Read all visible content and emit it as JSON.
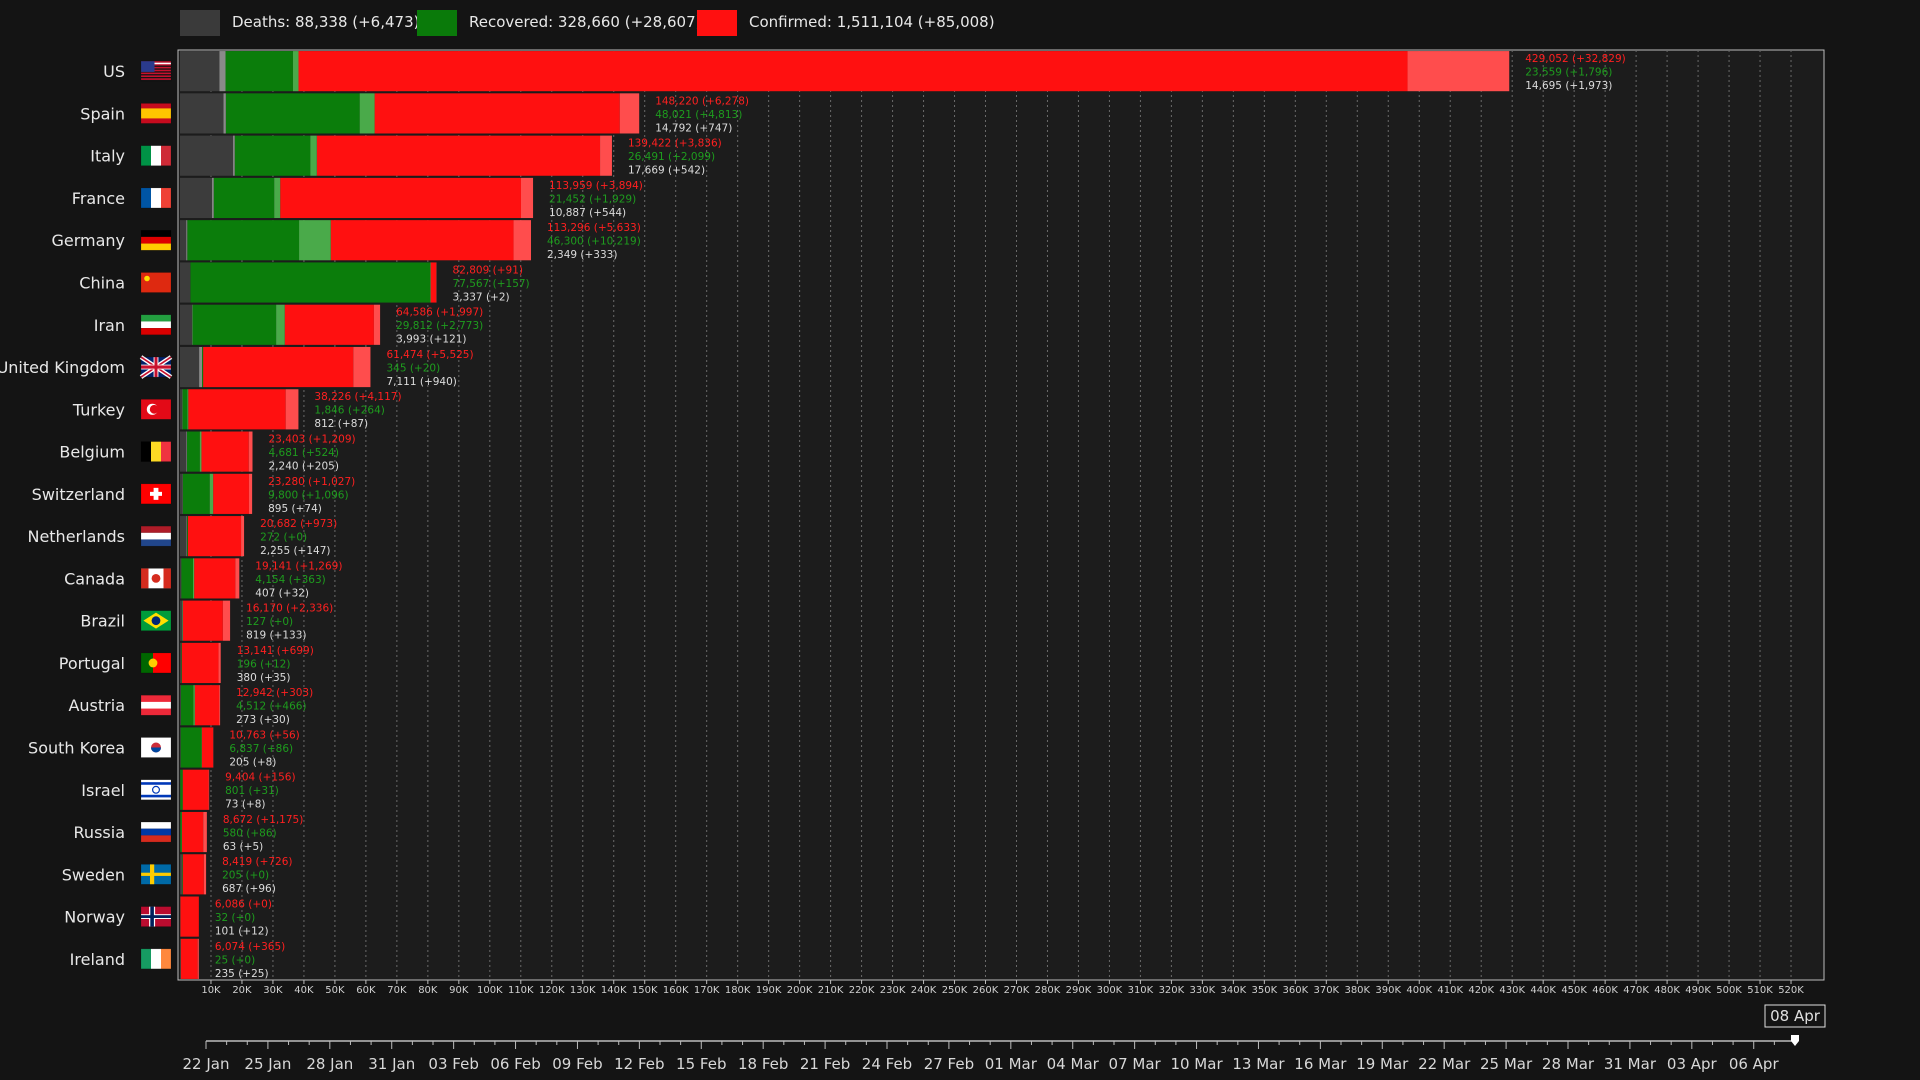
{
  "legend": [
    {
      "label": "Deaths: 88,338 (+6,473)",
      "color": "#3a3a3a"
    },
    {
      "label": "Recovered: 328,660 (+28,607)",
      "color": "#0a7a0a"
    },
    {
      "label": "Confirmed: 1,511,104 (+85,008)",
      "color": "#ff1010"
    }
  ],
  "colors": {
    "deaths": "#3c3c3c",
    "deaths_new": "#8a8a8a",
    "recovered": "#0b7d0b",
    "recovered_new": "#4aaa4a",
    "confirmed": "#ff1010",
    "confirmed_new": "#ff4d4d",
    "label_confirmed": "#ff2020",
    "label_recovered": "#1e9c1e",
    "label_deaths": "#dcdcdc"
  },
  "chart_data": {
    "type": "bar",
    "orientation": "horizontal",
    "stacked": true,
    "xlim": [
      0,
      530000
    ],
    "tick_values": [
      10000,
      20000,
      30000,
      40000,
      50000,
      60000,
      70000,
      80000,
      90000,
      100000,
      110000,
      120000,
      130000,
      140000,
      150000,
      160000,
      170000,
      180000,
      190000,
      200000,
      210000,
      220000,
      230000,
      240000,
      250000,
      260000,
      270000,
      280000,
      290000,
      300000,
      310000,
      320000,
      330000,
      340000,
      350000,
      360000,
      370000,
      380000,
      390000,
      400000,
      410000,
      420000,
      430000,
      440000,
      450000,
      460000,
      470000,
      480000,
      490000,
      500000,
      510000,
      520000
    ],
    "tick_labels": [
      "10K",
      "20K",
      "30K",
      "40K",
      "50K",
      "60K",
      "70K",
      "80K",
      "90K",
      "100K",
      "110K",
      "120K",
      "130K",
      "140K",
      "150K",
      "160K",
      "170K",
      "180K",
      "190K",
      "200K",
      "210K",
      "220K",
      "230K",
      "240K",
      "250K",
      "260K",
      "270K",
      "280K",
      "290K",
      "300K",
      "310K",
      "320K",
      "330K",
      "340K",
      "350K",
      "360K",
      "370K",
      "380K",
      "390K",
      "400K",
      "410K",
      "420K",
      "430K",
      "440K",
      "450K",
      "460K",
      "470K",
      "480K",
      "490K",
      "500K",
      "510K",
      "520K"
    ],
    "grid": true,
    "legend_position": "top-left",
    "countries": [
      {
        "name": "US",
        "flag": "us",
        "confirmed": 429052,
        "confirmed_new": 32829,
        "recovered": 23559,
        "recovered_new": 1796,
        "deaths": 14695,
        "deaths_new": 1973,
        "lbl_c": "429,052 (+32,829)",
        "lbl_r": "23,559 (+1,796)",
        "lbl_d": "14,695 (+1,973)"
      },
      {
        "name": "Spain",
        "flag": "es",
        "confirmed": 148220,
        "confirmed_new": 6278,
        "recovered": 48021,
        "recovered_new": 4813,
        "deaths": 14792,
        "deaths_new": 747,
        "lbl_c": "148,220 (+6,278)",
        "lbl_r": "48,021 (+4,813)",
        "lbl_d": "14,792 (+747)"
      },
      {
        "name": "Italy",
        "flag": "it",
        "confirmed": 139422,
        "confirmed_new": 3836,
        "recovered": 26491,
        "recovered_new": 2099,
        "deaths": 17669,
        "deaths_new": 542,
        "lbl_c": "139,422 (+3,836)",
        "lbl_r": "26,491 (+2,099)",
        "lbl_d": "17,669 (+542)"
      },
      {
        "name": "France",
        "flag": "fr",
        "confirmed": 113959,
        "confirmed_new": 3894,
        "recovered": 21452,
        "recovered_new": 1929,
        "deaths": 10887,
        "deaths_new": 544,
        "lbl_c": "113,959 (+3,894)",
        "lbl_r": "21,452 (+1,929)",
        "lbl_d": "10,887 (+544)"
      },
      {
        "name": "Germany",
        "flag": "de",
        "confirmed": 113296,
        "confirmed_new": 5633,
        "recovered": 46300,
        "recovered_new": 10219,
        "deaths": 2349,
        "deaths_new": 333,
        "lbl_c": "113,296 (+5,633)",
        "lbl_r": "46,300 (+10,219)",
        "lbl_d": "2,349 (+333)"
      },
      {
        "name": "China",
        "flag": "cn",
        "confirmed": 82809,
        "confirmed_new": 91,
        "recovered": 77567,
        "recovered_new": 157,
        "deaths": 3337,
        "deaths_new": 2,
        "lbl_c": "82,809 (+91)",
        "lbl_r": "77,567 (+157)",
        "lbl_d": "3,337 (+2)"
      },
      {
        "name": "Iran",
        "flag": "ir",
        "confirmed": 64586,
        "confirmed_new": 1997,
        "recovered": 29812,
        "recovered_new": 2773,
        "deaths": 3993,
        "deaths_new": 121,
        "lbl_c": "64,586 (+1,997)",
        "lbl_r": "29,812 (+2,773)",
        "lbl_d": "3,993 (+121)"
      },
      {
        "name": "United Kingdom",
        "flag": "gb",
        "confirmed": 61474,
        "confirmed_new": 5525,
        "recovered": 345,
        "recovered_new": 20,
        "deaths": 7111,
        "deaths_new": 940,
        "lbl_c": "61,474 (+5,525)",
        "lbl_r": "345 (+20)",
        "lbl_d": "7,111 (+940)"
      },
      {
        "name": "Turkey",
        "flag": "tr",
        "confirmed": 38226,
        "confirmed_new": 4117,
        "recovered": 1846,
        "recovered_new": 264,
        "deaths": 812,
        "deaths_new": 87,
        "lbl_c": "38,226 (+4,117)",
        "lbl_r": "1,846 (+264)",
        "lbl_d": "812 (+87)"
      },
      {
        "name": "Belgium",
        "flag": "be",
        "confirmed": 23403,
        "confirmed_new": 1209,
        "recovered": 4681,
        "recovered_new": 524,
        "deaths": 2240,
        "deaths_new": 205,
        "lbl_c": "23,403 (+1,209)",
        "lbl_r": "4,681 (+524)",
        "lbl_d": "2,240 (+205)"
      },
      {
        "name": "Switzerland",
        "flag": "ch",
        "confirmed": 23280,
        "confirmed_new": 1027,
        "recovered": 9800,
        "recovered_new": 1096,
        "deaths": 895,
        "deaths_new": 74,
        "lbl_c": "23,280 (+1,027)",
        "lbl_r": "9,800 (+1,096)",
        "lbl_d": "895 (+74)"
      },
      {
        "name": "Netherlands",
        "flag": "nl",
        "confirmed": 20682,
        "confirmed_new": 973,
        "recovered": 272,
        "recovered_new": 0,
        "deaths": 2255,
        "deaths_new": 147,
        "lbl_c": "20,682 (+973)",
        "lbl_r": "272 (+0)",
        "lbl_d": "2,255 (+147)"
      },
      {
        "name": "Canada",
        "flag": "ca",
        "confirmed": 19141,
        "confirmed_new": 1269,
        "recovered": 4154,
        "recovered_new": 363,
        "deaths": 407,
        "deaths_new": 32,
        "lbl_c": "19,141 (+1,269)",
        "lbl_r": "4,154 (+363)",
        "lbl_d": "407 (+32)"
      },
      {
        "name": "Brazil",
        "flag": "br",
        "confirmed": 16170,
        "confirmed_new": 2336,
        "recovered": 127,
        "recovered_new": 0,
        "deaths": 819,
        "deaths_new": 133,
        "lbl_c": "16,170 (+2,336)",
        "lbl_r": "127 (+0)",
        "lbl_d": "819 (+133)"
      },
      {
        "name": "Portugal",
        "flag": "pt",
        "confirmed": 13141,
        "confirmed_new": 699,
        "recovered": 196,
        "recovered_new": 12,
        "deaths": 380,
        "deaths_new": 35,
        "lbl_c": "13,141 (+699)",
        "lbl_r": "196 (+12)",
        "lbl_d": "380 (+35)"
      },
      {
        "name": "Austria",
        "flag": "at",
        "confirmed": 12942,
        "confirmed_new": 303,
        "recovered": 4512,
        "recovered_new": 466,
        "deaths": 273,
        "deaths_new": 30,
        "lbl_c": "12,942 (+303)",
        "lbl_r": "4,512 (+466)",
        "lbl_d": "273 (+30)"
      },
      {
        "name": "South Korea",
        "flag": "kr",
        "confirmed": 10763,
        "confirmed_new": 56,
        "recovered": 6837,
        "recovered_new": 86,
        "deaths": 205,
        "deaths_new": 8,
        "lbl_c": "10,763 (+56)",
        "lbl_r": "6,837 (+86)",
        "lbl_d": "205 (+8)"
      },
      {
        "name": "Israel",
        "flag": "il",
        "confirmed": 9404,
        "confirmed_new": 156,
        "recovered": 801,
        "recovered_new": 31,
        "deaths": 73,
        "deaths_new": 8,
        "lbl_c": "9,404 (+156)",
        "lbl_r": "801 (+31)",
        "lbl_d": "73 (+8)"
      },
      {
        "name": "Russia",
        "flag": "ru",
        "confirmed": 8672,
        "confirmed_new": 1175,
        "recovered": 580,
        "recovered_new": 86,
        "deaths": 63,
        "deaths_new": 5,
        "lbl_c": "8,672 (+1,175)",
        "lbl_r": "580 (+86)",
        "lbl_d": "63 (+5)"
      },
      {
        "name": "Sweden",
        "flag": "se",
        "confirmed": 8419,
        "confirmed_new": 726,
        "recovered": 205,
        "recovered_new": 0,
        "deaths": 687,
        "deaths_new": 96,
        "lbl_c": "8,419 (+726)",
        "lbl_r": "205 (+0)",
        "lbl_d": "687 (+96)"
      },
      {
        "name": "Norway",
        "flag": "no",
        "confirmed": 6086,
        "confirmed_new": 0,
        "recovered": 32,
        "recovered_new": 0,
        "deaths": 101,
        "deaths_new": 12,
        "lbl_c": "6,086 (+0)",
        "lbl_r": "32 (+0)",
        "lbl_d": "101 (+12)"
      },
      {
        "name": "Ireland",
        "flag": "ie",
        "confirmed": 6074,
        "confirmed_new": 365,
        "recovered": 25,
        "recovered_new": 0,
        "deaths": 235,
        "deaths_new": 25,
        "lbl_c": "6,074 (+365)",
        "lbl_r": "25 (+0)",
        "lbl_d": "235 (+25)"
      }
    ]
  },
  "timeline": {
    "labels": [
      "22 Jan",
      "25 Jan",
      "28 Jan",
      "31 Jan",
      "03 Feb",
      "06 Feb",
      "09 Feb",
      "12 Feb",
      "15 Feb",
      "18 Feb",
      "21 Feb",
      "24 Feb",
      "27 Feb",
      "01 Mar",
      "04 Mar",
      "07 Mar",
      "10 Mar",
      "13 Mar",
      "16 Mar",
      "19 Mar",
      "22 Mar",
      "25 Mar",
      "28 Mar",
      "31 Mar",
      "03 Apr",
      "06 Apr"
    ],
    "current_date": "08 Apr",
    "total_days": 78,
    "current_day": 77
  }
}
